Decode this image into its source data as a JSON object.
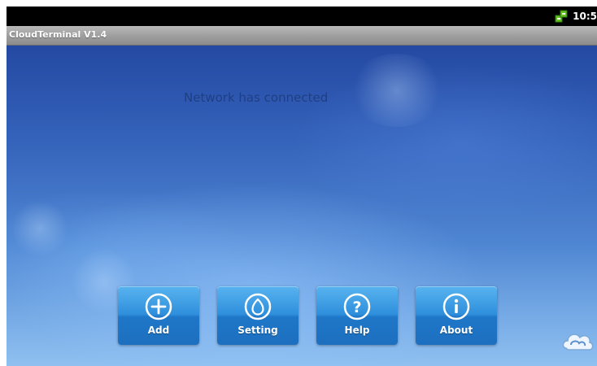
{
  "statusbar": {
    "time": "10:5",
    "network_icon": "network-icon"
  },
  "app": {
    "title": "CloudTerminal V1.4"
  },
  "main": {
    "status_message": "Network has connected"
  },
  "buttons": [
    {
      "label": "Add",
      "icon": "plus-icon"
    },
    {
      "label": "Setting",
      "icon": "setting-icon"
    },
    {
      "label": "Help",
      "icon": "help-icon"
    },
    {
      "label": "About",
      "icon": "info-icon"
    }
  ],
  "logo": {
    "icon": "cloud-logo-icon"
  },
  "colors": {
    "background_top": "#2449a3",
    "background_bottom": "#8fc0f0",
    "tile": "#2f8fdc",
    "message_text": "#1f3f83"
  }
}
